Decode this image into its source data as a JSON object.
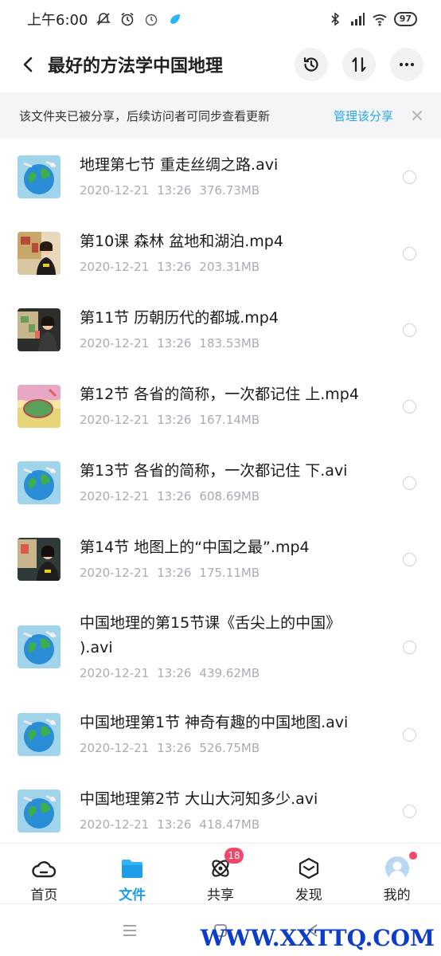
{
  "status_bar": {
    "time": "上午6:00",
    "battery": "97"
  },
  "header": {
    "title": "最好的方法学中国地理"
  },
  "banner": {
    "text": "该文件夹已被分享，后续访问者可同步查看更新",
    "link": "管理该分享"
  },
  "files": [
    {
      "name": "地理第七节 重走丝绸之路.avi",
      "date": "2020-12-21",
      "time": "13:26",
      "size": "376.73MB",
      "thumb": "globe-video"
    },
    {
      "name": "第10课 森林 盆地和湖泊.mp4",
      "date": "2020-12-21",
      "time": "13:26",
      "size": "203.31MB",
      "thumb": "teacher-video"
    },
    {
      "name": "第11节 历朝历代的都城.mp4",
      "date": "2020-12-21",
      "time": "13:26",
      "size": "183.53MB",
      "thumb": "teacher-video"
    },
    {
      "name": "第12节 各省的简称，一次都记住 上.mp4",
      "date": "2020-12-21",
      "time": "13:26",
      "size": "167.14MB",
      "thumb": "map-video"
    },
    {
      "name": "第13节 各省的简称，一次都记住 下.avi",
      "date": "2020-12-21",
      "time": "13:26",
      "size": "608.69MB",
      "thumb": "globe-video"
    },
    {
      "name": "第14节 地图上的“中国之最”.mp4",
      "date": "2020-12-21",
      "time": "13:26",
      "size": "175.11MB",
      "thumb": "teacher-video"
    },
    {
      "name": "中国地理的第15节课《舌尖上的中国》 ).avi",
      "date": "2020-12-21",
      "time": "13:26",
      "size": "439.62MB",
      "thumb": "globe-video"
    },
    {
      "name": "中国地理第1节 神奇有趣的中国地图.avi",
      "date": "2020-12-21",
      "time": "13:26",
      "size": "526.75MB",
      "thumb": "globe-video"
    },
    {
      "name": "中国地理第2节  大山大河知多少.avi",
      "date": "2020-12-21",
      "time": "13:26",
      "size": "418.47MB",
      "thumb": "globe-video"
    }
  ],
  "bottom_nav": [
    {
      "label": "首页",
      "icon": "cloud-icon",
      "active": false
    },
    {
      "label": "文件",
      "icon": "folder-icon",
      "active": true
    },
    {
      "label": "共享",
      "icon": "atom-icon",
      "active": false,
      "badge": "18"
    },
    {
      "label": "发现",
      "icon": "box-icon",
      "active": false
    },
    {
      "label": "我的",
      "icon": "avatar-icon",
      "active": false,
      "dot": true
    }
  ],
  "watermark": "WWW.XXTTQ.COM",
  "colors": {
    "accent": "#1e9de8",
    "link": "#2aa6e6",
    "badge": "#f0476b",
    "meta_gray": "#a8adb4"
  }
}
